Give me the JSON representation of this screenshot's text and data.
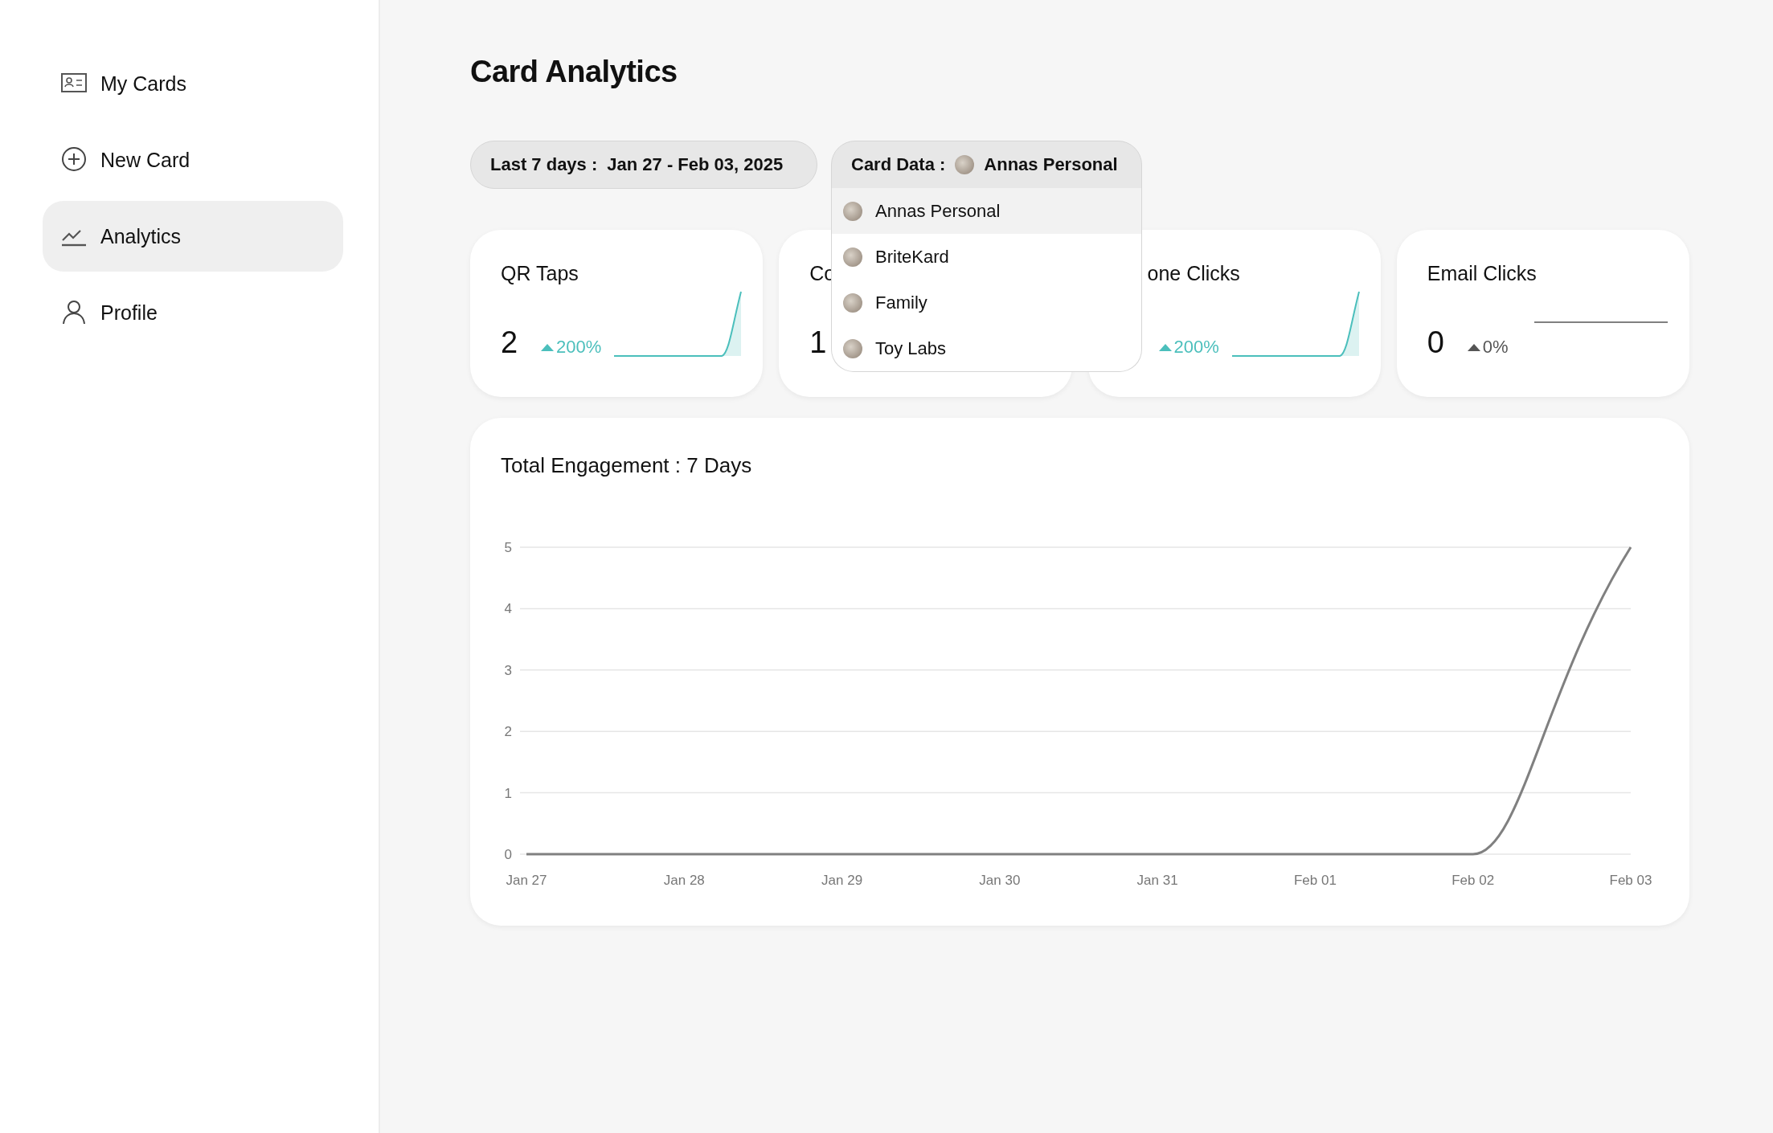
{
  "sidebar": {
    "items": [
      {
        "label": "My Cards",
        "selected": false
      },
      {
        "label": "New Card",
        "selected": false
      },
      {
        "label": "Analytics",
        "selected": true
      },
      {
        "label": "Profile",
        "selected": false
      }
    ]
  },
  "page": {
    "title": "Card Analytics"
  },
  "filters": {
    "range": {
      "label": "Last 7 days :",
      "value": "Jan 27 - Feb 03, 2025"
    },
    "card_data": {
      "label": "Card Data :",
      "value": "Annas Personal",
      "expanded": true,
      "options": [
        {
          "label": "Annas Personal",
          "selected": true
        },
        {
          "label": "BriteKard",
          "selected": false
        },
        {
          "label": "Family",
          "selected": false
        },
        {
          "label": "Toy Labs",
          "selected": false
        }
      ]
    }
  },
  "stats": [
    {
      "kind": "rising",
      "title": "QR Taps",
      "value": "2",
      "change": "200%"
    },
    {
      "kind": "plain",
      "title": "Co",
      "value": "1"
    },
    {
      "kind": "rising",
      "title": "one Clicks",
      "change": "200%"
    },
    {
      "kind": "flat",
      "title": "Email Clicks",
      "value": "0",
      "change": "0%"
    }
  ],
  "engagement": {
    "title": "Total Engagement : 7 Days",
    "chart_data": {
      "type": "line",
      "categories": [
        "Jan 27",
        "Jan 28",
        "Jan 29",
        "Jan 30",
        "Jan 31",
        "Feb 01",
        "Feb 02",
        "Feb 03"
      ],
      "series": [
        {
          "color": "#808080",
          "values": [
            0,
            0,
            0,
            0,
            0,
            0,
            0,
            5
          ]
        }
      ],
      "ylim": [
        0,
        5
      ],
      "yticks": [
        0,
        1,
        2,
        3,
        4,
        5
      ],
      "grid": true
    }
  }
}
